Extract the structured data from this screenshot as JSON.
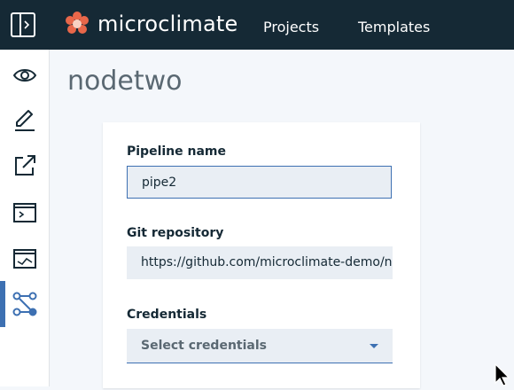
{
  "header": {
    "brand": "microclimate",
    "nav": [
      {
        "label": "Projects"
      },
      {
        "label": "Templates"
      }
    ]
  },
  "sidebar": {
    "items": [
      {
        "icon": "eye-icon",
        "active": false
      },
      {
        "icon": "edit-icon",
        "active": false
      },
      {
        "icon": "launch-icon",
        "active": false
      },
      {
        "icon": "terminal-icon",
        "active": false
      },
      {
        "icon": "monitor-icon",
        "active": false
      },
      {
        "icon": "pipeline-icon",
        "active": true
      }
    ]
  },
  "page": {
    "title": "nodetwo"
  },
  "form": {
    "pipeline_label": "Pipeline name",
    "pipeline_value": "pipe2",
    "git_label": "Git repository",
    "git_value": "https://github.com/microclimate-demo/no",
    "credentials_label": "Credentials",
    "credentials_placeholder": "Select credentials"
  },
  "colors": {
    "topbar": "#152935",
    "accent": "#3d70b2",
    "field_bg": "#e9eef4",
    "logo": "#e8674a"
  }
}
